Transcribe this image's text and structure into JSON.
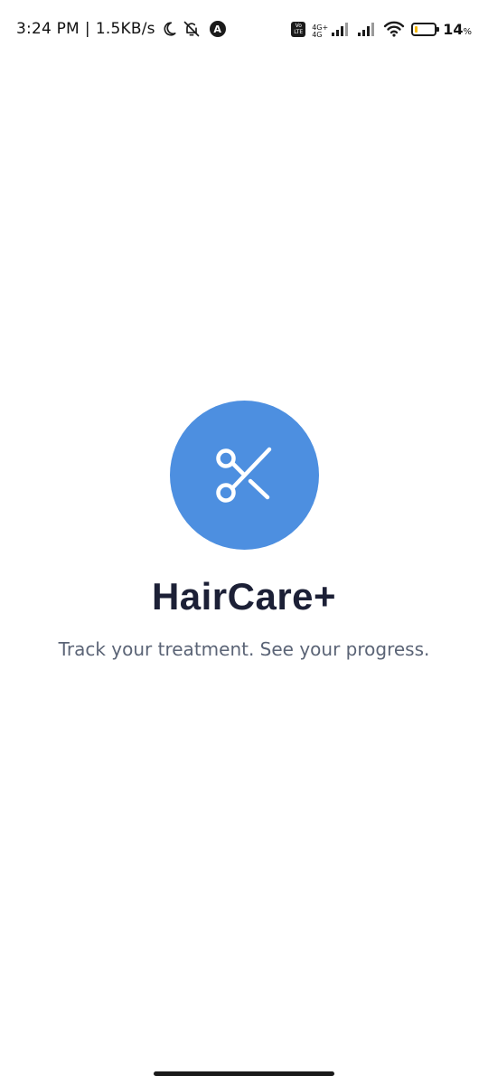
{
  "status_bar": {
    "time": "3:24 PM",
    "separator": "|",
    "net_speed": "1.5KB/s",
    "network_type": "4G+",
    "network_type_sub": "4G",
    "volte_line1": "Vo",
    "volte_line2": "LTE",
    "app_badge": "A",
    "battery_percent": "14",
    "battery_unit": "%",
    "battery_level": 0.14,
    "battery_color": "#f5b800"
  },
  "splash": {
    "logo_icon": "scissors-icon",
    "logo_color": "#4d8fe0",
    "app_name": "HairCare+",
    "tagline": "Track your treatment. See your progress."
  }
}
